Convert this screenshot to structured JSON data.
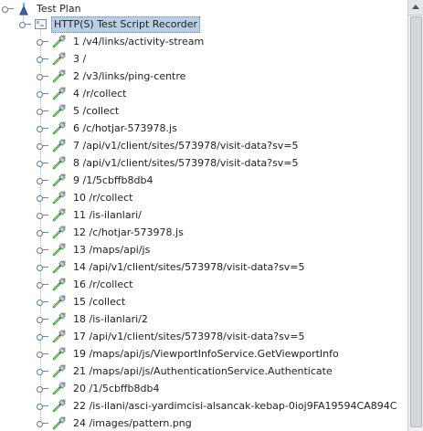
{
  "tree": {
    "root_label": "Test Plan",
    "recorder_label": "HTTP(S) Test Script Recorder",
    "samplers": [
      "1 /v4/links/activity-stream",
      "3 /",
      "2 /v3/links/ping-centre",
      "4 /r/collect",
      "5 /collect",
      "6 /c/hotjar-573978.js",
      "7 /api/v1/client/sites/573978/visit-data?sv=5",
      "8 /api/v1/client/sites/573978/visit-data?sv=5",
      "9 /1/5cbffb8db4",
      "10 /r/collect",
      "11 /is-ilanlari/",
      "12 /c/hotjar-573978.js",
      "13 /maps/api/js",
      "14 /api/v1/client/sites/573978/visit-data?sv=5",
      "16 /r/collect",
      "15 /collect",
      "18 /is-ilanlari/2",
      "17 /api/v1/client/sites/573978/visit-data?sv=5",
      "19 /maps/api/js/ViewportInfoService.GetViewportInfo",
      "21 /maps/api/js/AuthenticationService.Authenticate",
      "20 /1/5cbffb8db4",
      "22 /is-ilani/asci-yardimcisi-alsancak-kebap-0ioj9FA19594CA894C",
      "24 /images/pattern.png"
    ]
  },
  "icons": {
    "root": "test-plan-icon",
    "recorder": "recorder-icon",
    "sampler": "dropper-icon",
    "expand": "tree-expand-icon"
  },
  "colors": {
    "selection_bg": "#b8cfe5",
    "scrollbar_bg": "#eef0f3"
  }
}
